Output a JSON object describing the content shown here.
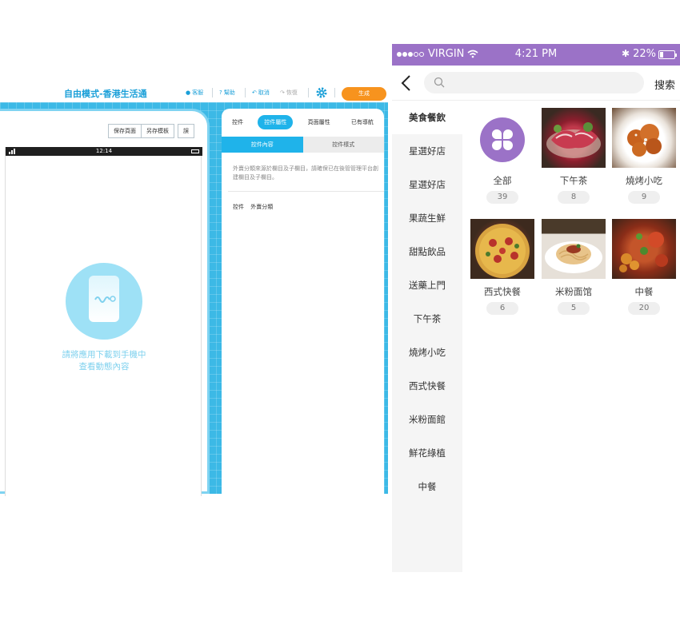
{
  "editor": {
    "title": "自由模式-香港生活通",
    "toolbar": {
      "support": "客服",
      "help": "幫助",
      "undo": "取消",
      "redo": "恢復",
      "generate": "生成"
    },
    "phone": {
      "save_page": "保存頁面",
      "save_template": "另存模板",
      "extra": "誤",
      "time": "12:14",
      "download_hint_line1": "請將應用下載到手機中",
      "download_hint_line2": "查看動態內容"
    },
    "props": {
      "tabs": [
        "控件",
        "控件屬性",
        "頁面屬性",
        "已有導航"
      ],
      "active_tab": 1,
      "subtabs": [
        "控件內容",
        "控件樣式"
      ],
      "description": "外賣分類來源於欄目及子欄目，請確保已在後管管理平台創建欄目及子欄目。",
      "control_label": "控件",
      "control_value": "外賣分類"
    }
  },
  "app": {
    "status": {
      "carrier": "VIRGIN",
      "time": "4:21 PM",
      "battery": "22%",
      "battery_level": 0.22
    },
    "search": {
      "placeholder": "",
      "button": "搜索"
    },
    "sidebar": [
      {
        "label": "美食餐飲",
        "active": true
      },
      {
        "label": "星選好店"
      },
      {
        "label": "星選好店"
      },
      {
        "label": "果蔬生鮮"
      },
      {
        "label": "甜點飲品"
      },
      {
        "label": "送藥上門"
      },
      {
        "label": "下午茶"
      },
      {
        "label": "燒烤小吃"
      },
      {
        "label": "西式快餐"
      },
      {
        "label": "米粉面館"
      },
      {
        "label": "鮮花綠植"
      },
      {
        "label": "中餐"
      }
    ],
    "categories": [
      {
        "name": "全部",
        "count": "39",
        "icon": "clover-icon"
      },
      {
        "name": "下午茶",
        "count": "8",
        "image": "meat-platter"
      },
      {
        "name": "燒烤小吃",
        "count": "9",
        "image": "fried-chicken"
      },
      {
        "name": "西式快餐",
        "count": "6",
        "image": "pizza"
      },
      {
        "name": "米粉面馆",
        "count": "5",
        "image": "spaghetti"
      },
      {
        "name": "中餐",
        "count": "20",
        "image": "chinese-dishes"
      }
    ],
    "colors": {
      "accent": "#9b72c7",
      "editor_blue": "#1fb3ea",
      "generate_orange": "#f7931e"
    }
  }
}
